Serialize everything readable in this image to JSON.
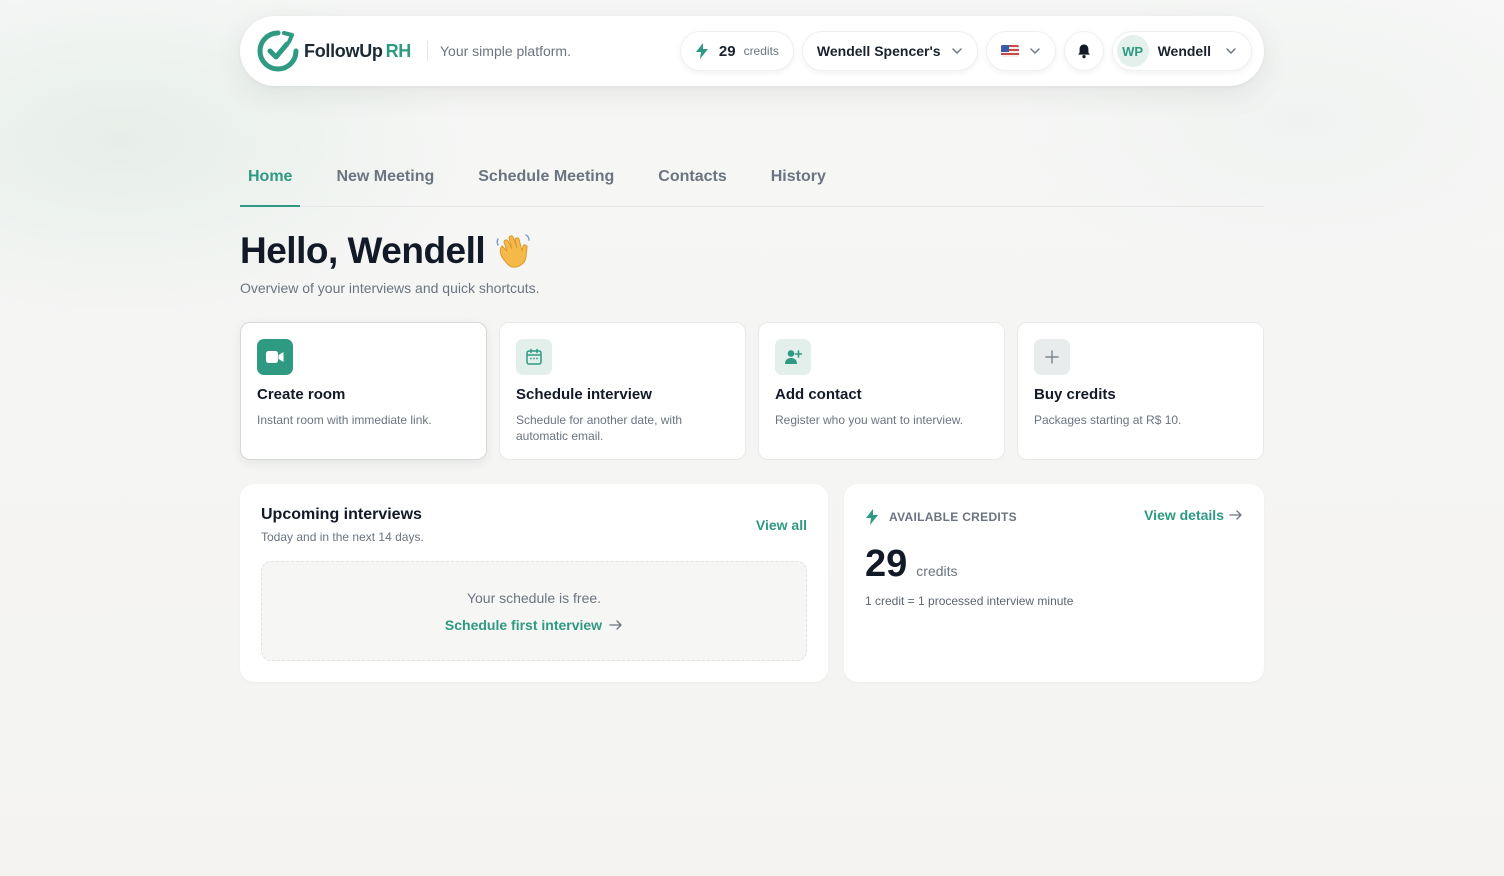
{
  "header": {
    "brand_name": "FollowUp",
    "brand_accent": "RH",
    "tagline": "Your simple platform.",
    "credits_count": "29",
    "credits_unit": "credits",
    "org_name": "Wendell Spencer's",
    "user_initials": "WP",
    "user_name": "Wendell"
  },
  "tabs": [
    {
      "label": "Home",
      "active": true
    },
    {
      "label": "New Meeting"
    },
    {
      "label": "Schedule Meeting"
    },
    {
      "label": "Contacts"
    },
    {
      "label": "History"
    }
  ],
  "greeting": {
    "title": "Hello, Wendell",
    "subtitle": "Overview of your interviews and quick shortcuts."
  },
  "actions": [
    {
      "icon": "video-camera-icon",
      "title": "Create room",
      "desc": "Instant room with immediate link."
    },
    {
      "icon": "calendar-icon",
      "title": "Schedule interview",
      "desc": "Schedule for another date, with automatic email."
    },
    {
      "icon": "add-user-icon",
      "title": "Add contact",
      "desc": "Register who you want to interview."
    },
    {
      "icon": "plus-icon",
      "title": "Buy credits",
      "desc": "Packages starting at R$ 10."
    }
  ],
  "upcoming": {
    "title": "Upcoming interviews",
    "subtitle": "Today and in the next 14 days.",
    "view_all": "View all",
    "empty_text": "Your schedule is free.",
    "empty_cta": "Schedule first interview"
  },
  "credits_panel": {
    "label": "AVAILABLE CREDITS",
    "view_details": "View details",
    "count": "29",
    "unit": "credits",
    "rate": "1 credit = 1 processed interview minute"
  },
  "colors": {
    "accent": "#2e9a82",
    "text_dark": "#121a27",
    "text_muted": "#6b7480"
  }
}
